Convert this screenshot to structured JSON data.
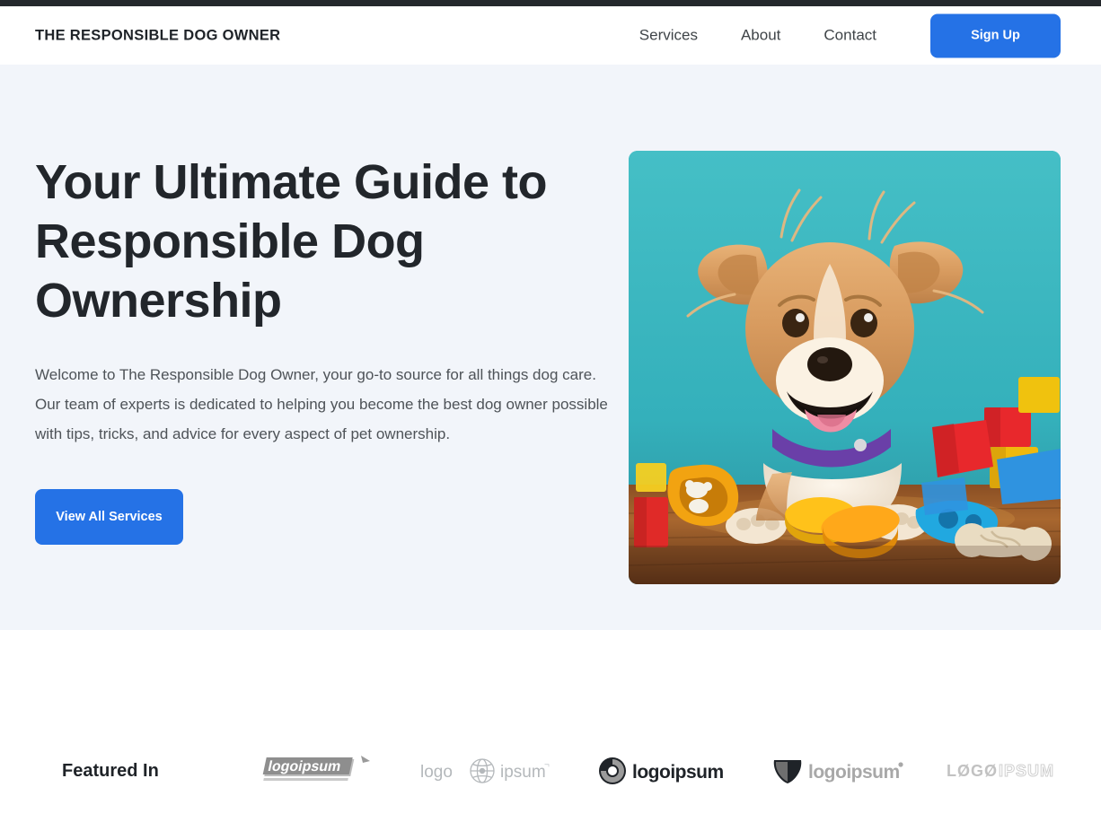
{
  "topbar": {
    "color": "#24282c"
  },
  "header": {
    "brand": "THE RESPONSIBLE DOG OWNER",
    "nav": [
      {
        "label": "Services"
      },
      {
        "label": "About"
      },
      {
        "label": "Contact"
      }
    ],
    "signup_label": "Sign Up",
    "accent_color": "#2572e6"
  },
  "hero": {
    "background_color": "#f2f5fa",
    "title": "Your Ultimate Guide to Responsible Dog Ownership",
    "paragraph": "Welcome to The Responsible Dog Owner, your go-to source for all things dog care. Our team of experts is dedicated to helping you become the best dog owner possible with tips, tricks, and advice for every aspect of pet ownership.",
    "cta_label": "View All Services",
    "image_alt": "Happy smiling dog lying on wooden floor surrounded by colorful toys on a teal background"
  },
  "featured": {
    "label": "Featured In",
    "logos": [
      {
        "name": "logoipsum-italic-3d",
        "text": "logoipsum"
      },
      {
        "name": "logo-globe-ipsum",
        "text_left": "logo",
        "text_right": "ipsum"
      },
      {
        "name": "logoipsum-circle-mark",
        "text": "logoipsum"
      },
      {
        "name": "logoipsum-triangle-mark",
        "text": "logoipsum"
      },
      {
        "name": "logoipsum-outline-caps",
        "text_left": "LØGØ",
        "text_right": "IPSUM"
      }
    ]
  }
}
